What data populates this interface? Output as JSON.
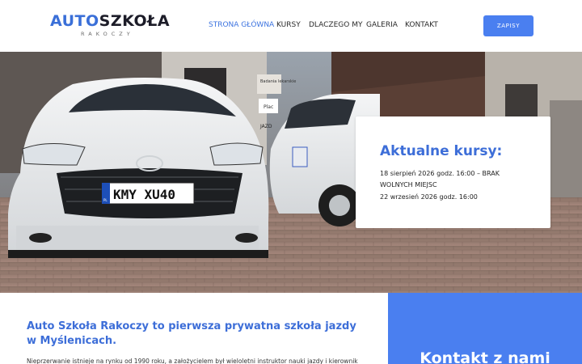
{
  "brand": {
    "name_part1": "AUTO",
    "name_part2": "SZKOŁA",
    "subtitle": "RAKOCZY"
  },
  "nav": {
    "items": [
      {
        "label": "STRONA GŁÓWNA",
        "active": true
      },
      {
        "label": "KURSY",
        "active": false
      },
      {
        "label": "DLACZEGO MY",
        "active": false
      },
      {
        "label": "GALERIA",
        "active": false
      },
      {
        "label": "KONTAKT",
        "active": false
      }
    ],
    "cta_label": "ZAPISY"
  },
  "hero": {
    "plate_text": "KMY XU40",
    "plate_country": "PL",
    "signs": [
      "Badania lekarskie",
      "Plac",
      "JAZD"
    ]
  },
  "courses": {
    "title": "Aktualne kursy:",
    "items": [
      "18 sierpień 2026 godz. 16:00 – BRAK WOLNYCH MIEJSC",
      "22 wrzesień 2026 godz. 16:00"
    ]
  },
  "intro": {
    "title": "Auto Szkoła Rakoczy to pierwsza prywatna szkoła jazdy w Myślenicach.",
    "text": "Nieprzerwanie istnieje na rynku od 1990 roku, a założycielem był wieloletni instruktor nauki jazdy i kierownik"
  },
  "contact": {
    "title": "Kontakt z nami"
  },
  "colors": {
    "accent": "#3d6ed8",
    "button": "#4a7ff0",
    "text_dark": "#1c1c28"
  }
}
